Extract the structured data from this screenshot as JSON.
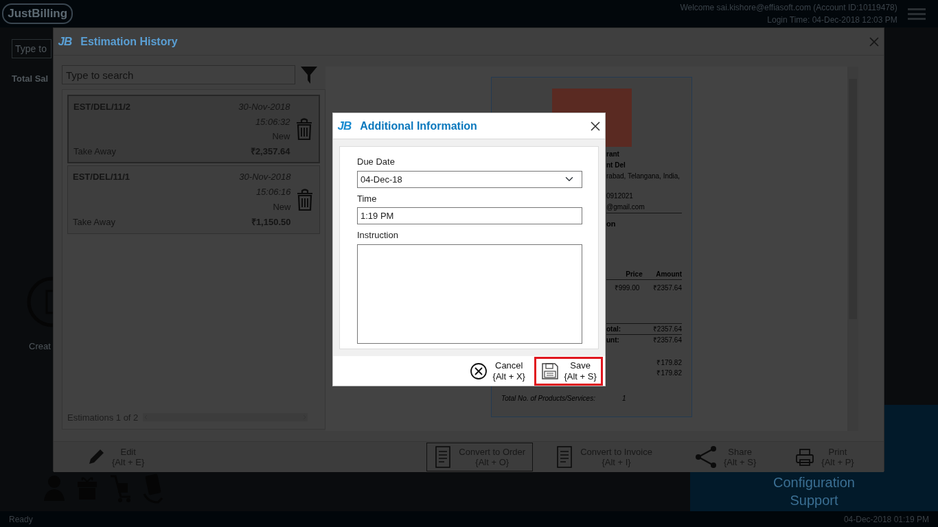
{
  "app": {
    "logo": "JustBilling",
    "welcome": "Welcome sai.kishore@effiasoft.com (Account ID:10119478)",
    "login_time": "Login Time: 04-Dec-2018 12:03 PM"
  },
  "background": {
    "search_placeholder": "Type to",
    "total_label": "Total Sal",
    "create_label": "Creat",
    "menu": [
      "Configuration",
      "Support"
    ]
  },
  "estimation_history": {
    "logo": "JB",
    "title": "Estimation History",
    "search": {
      "placeholder": "Type to search"
    },
    "estimations": [
      {
        "number": "EST/DEL/11/2",
        "date": "30-Nov-2018",
        "time": "15:06:32",
        "status": "New",
        "order_type": "Take Away",
        "amount": "₹2,357.64",
        "selected": true
      },
      {
        "number": "EST/DEL/11/1",
        "date": "30-Nov-2018",
        "time": "15:06:16",
        "status": "New",
        "order_type": "Take Away",
        "amount": "₹1,150.50",
        "selected": false
      }
    ],
    "footer": "Estimations 1 of 2",
    "receipt": {
      "store_lines": [
        {
          "text": "rant",
          "bold": true
        },
        {
          "text": "nt Del",
          "bold": true
        },
        {
          "text": "rabad, Telangana, India,",
          "bold": false
        },
        {
          "text": "0912021",
          "bold": false
        },
        {
          "text": "@gmail.com",
          "bold": false
        }
      ],
      "doc_title": "on",
      "columns": [
        "Price",
        "Amount"
      ],
      "item": [
        "₹999.00",
        "₹2357.64"
      ],
      "totals": [
        {
          "label": "otal:",
          "value": "₹2357.64"
        },
        {
          "label": "unt:",
          "value": "₹2357.64"
        }
      ],
      "taxes": [
        "₹179.82",
        "₹179.82"
      ],
      "product_count": {
        "label": "Total No. of Products/Services:",
        "value": "1"
      }
    },
    "toolbar": [
      {
        "kind": "edit",
        "label": "Edit",
        "shortcut": "{Alt + E}",
        "selected": false
      },
      {
        "kind": "order",
        "label": "Convert to Order",
        "shortcut": "{Alt + O}",
        "selected": true
      },
      {
        "kind": "invoice",
        "label": "Convert to Invoice",
        "shortcut": "{Alt + I}",
        "selected": false
      },
      {
        "kind": "share",
        "label": "Share",
        "shortcut": "{Alt + S}",
        "selected": false
      },
      {
        "kind": "print",
        "label": "Print",
        "shortcut": "{Alt + P}",
        "selected": false
      }
    ]
  },
  "additional_information": {
    "logo": "JB",
    "title": "Additional Information",
    "fields": [
      {
        "kind": "select",
        "label": "Due Date",
        "value": "04-Dec-18"
      },
      {
        "kind": "text",
        "label": "Time",
        "value": "1:19 PM"
      },
      {
        "kind": "textarea",
        "label": "Instruction"
      }
    ],
    "buttons": [
      {
        "kind": "cancel",
        "label": "Cancel",
        "shortcut": "{Alt + X}",
        "focused": false
      },
      {
        "kind": "save",
        "label": "Save",
        "shortcut": "{Alt + S}",
        "focused": true
      }
    ]
  },
  "status_bar": {
    "status": "Ready",
    "datetime": "04-Dec-2018 01:19 PM"
  }
}
